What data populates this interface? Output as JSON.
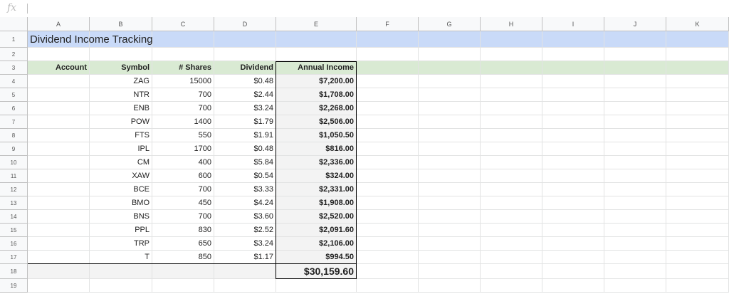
{
  "formula_bar": {
    "fx_label": "fx",
    "value": ""
  },
  "columns": [
    "A",
    "B",
    "C",
    "D",
    "E",
    "F",
    "G",
    "H",
    "I",
    "J",
    "K"
  ],
  "rows": [
    "1",
    "2",
    "3",
    "4",
    "5",
    "6",
    "7",
    "8",
    "9",
    "10",
    "11",
    "12",
    "13",
    "14",
    "15",
    "16",
    "17",
    "18",
    "19"
  ],
  "title": "Dividend Income Tracking",
  "headers": {
    "account": "Account",
    "symbol": "Symbol",
    "shares": "# Shares",
    "dividend": "Dividend",
    "annual": "Annual Income"
  },
  "holdings": [
    {
      "symbol": "ZAG",
      "shares": "15000",
      "dividend": "$0.48",
      "annual": "$7,200.00"
    },
    {
      "symbol": "NTR",
      "shares": "700",
      "dividend": "$2.44",
      "annual": "$1,708.00"
    },
    {
      "symbol": "ENB",
      "shares": "700",
      "dividend": "$3.24",
      "annual": "$2,268.00"
    },
    {
      "symbol": "POW",
      "shares": "1400",
      "dividend": "$1.79",
      "annual": "$2,506.00"
    },
    {
      "symbol": "FTS",
      "shares": "550",
      "dividend": "$1.91",
      "annual": "$1,050.50"
    },
    {
      "symbol": "IPL",
      "shares": "1700",
      "dividend": "$0.48",
      "annual": "$816.00"
    },
    {
      "symbol": "CM",
      "shares": "400",
      "dividend": "$5.84",
      "annual": "$2,336.00"
    },
    {
      "symbol": "XAW",
      "shares": "600",
      "dividend": "$0.54",
      "annual": "$324.00"
    },
    {
      "symbol": "BCE",
      "shares": "700",
      "dividend": "$3.33",
      "annual": "$2,331.00"
    },
    {
      "symbol": "BMO",
      "shares": "450",
      "dividend": "$4.24",
      "annual": "$1,908.00"
    },
    {
      "symbol": "BNS",
      "shares": "700",
      "dividend": "$3.60",
      "annual": "$2,520.00"
    },
    {
      "symbol": "PPL",
      "shares": "830",
      "dividend": "$2.52",
      "annual": "$2,091.60"
    },
    {
      "symbol": "TRP",
      "shares": "650",
      "dividend": "$3.24",
      "annual": "$2,106.00"
    },
    {
      "symbol": "T",
      "shares": "850",
      "dividend": "$1.17",
      "annual": "$994.50"
    }
  ],
  "total": "$30,159.60",
  "colors": {
    "title_fill": "#c9daf8",
    "header_fill": "#d9ead3",
    "total_fill": "#f3f3f3"
  }
}
